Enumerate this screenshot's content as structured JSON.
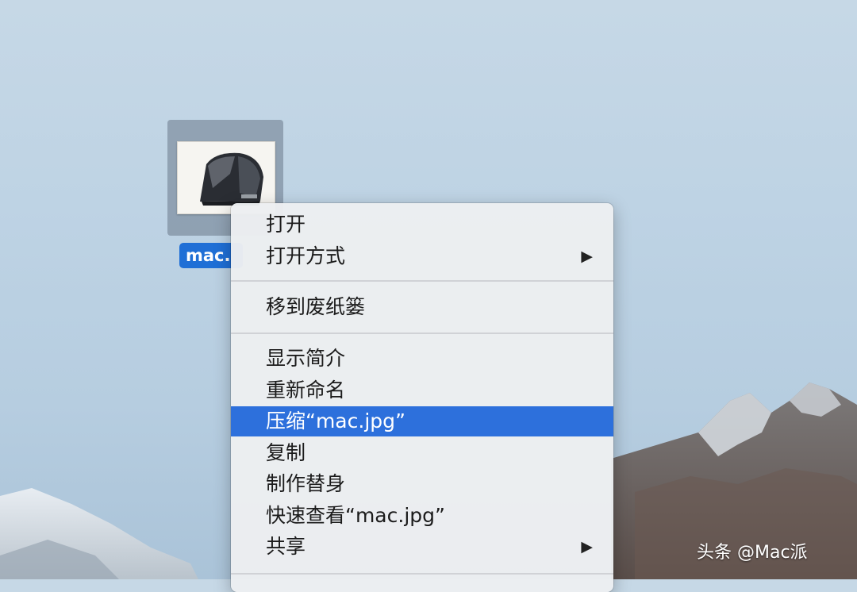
{
  "desktop": {
    "file": {
      "label": "mac.",
      "icon": "image-file-icon"
    }
  },
  "context_menu": {
    "items": [
      {
        "label": "打开",
        "has_submenu": false
      },
      {
        "label": "打开方式",
        "has_submenu": true
      },
      {
        "label": "移到废纸篓",
        "has_submenu": false
      },
      {
        "label": "显示简介",
        "has_submenu": false
      },
      {
        "label": "重新命名",
        "has_submenu": false
      },
      {
        "label": "压缩“mac.jpg”",
        "has_submenu": false,
        "highlighted": true
      },
      {
        "label": "复制",
        "has_submenu": false
      },
      {
        "label": "制作替身",
        "has_submenu": false
      },
      {
        "label": "快速查看“mac.jpg”",
        "has_submenu": false
      },
      {
        "label": "共享",
        "has_submenu": true
      }
    ],
    "submenu_arrow": "▶"
  },
  "watermark": "头条 @Mac派",
  "colors": {
    "highlight": "#2d70dc",
    "selection_label": "#1f6fd6",
    "menu_background": "#eceef1"
  }
}
